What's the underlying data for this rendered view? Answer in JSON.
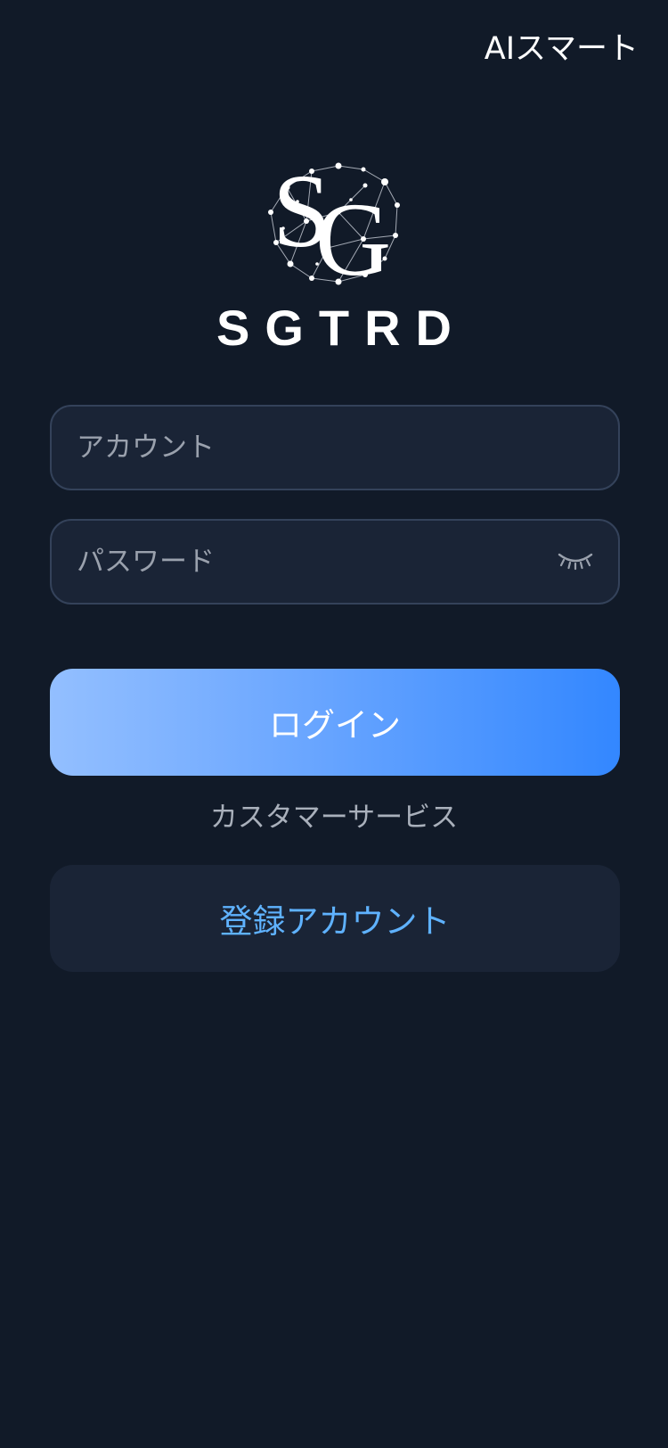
{
  "header": {
    "top_right_label": "AIスマート"
  },
  "brand": {
    "name": "SGTRD",
    "logo_icon": "sg-constellation-logo-icon"
  },
  "form": {
    "account_placeholder": "アカウント",
    "account_value": "",
    "password_placeholder": "パスワード",
    "password_value": "",
    "password_toggle_icon": "eye-closed-icon"
  },
  "actions": {
    "login_label": "ログイン",
    "customer_service_label": "カスタマーサービス",
    "register_label": "登録アカウント"
  },
  "colors": {
    "background": "#111a28",
    "field_background": "#1a2436",
    "field_border": "#34425a",
    "login_gradient_start": "#93bfff",
    "login_gradient_end": "#3387ff",
    "register_text": "#5fb2ff",
    "muted_text": "#a9b0bb"
  }
}
